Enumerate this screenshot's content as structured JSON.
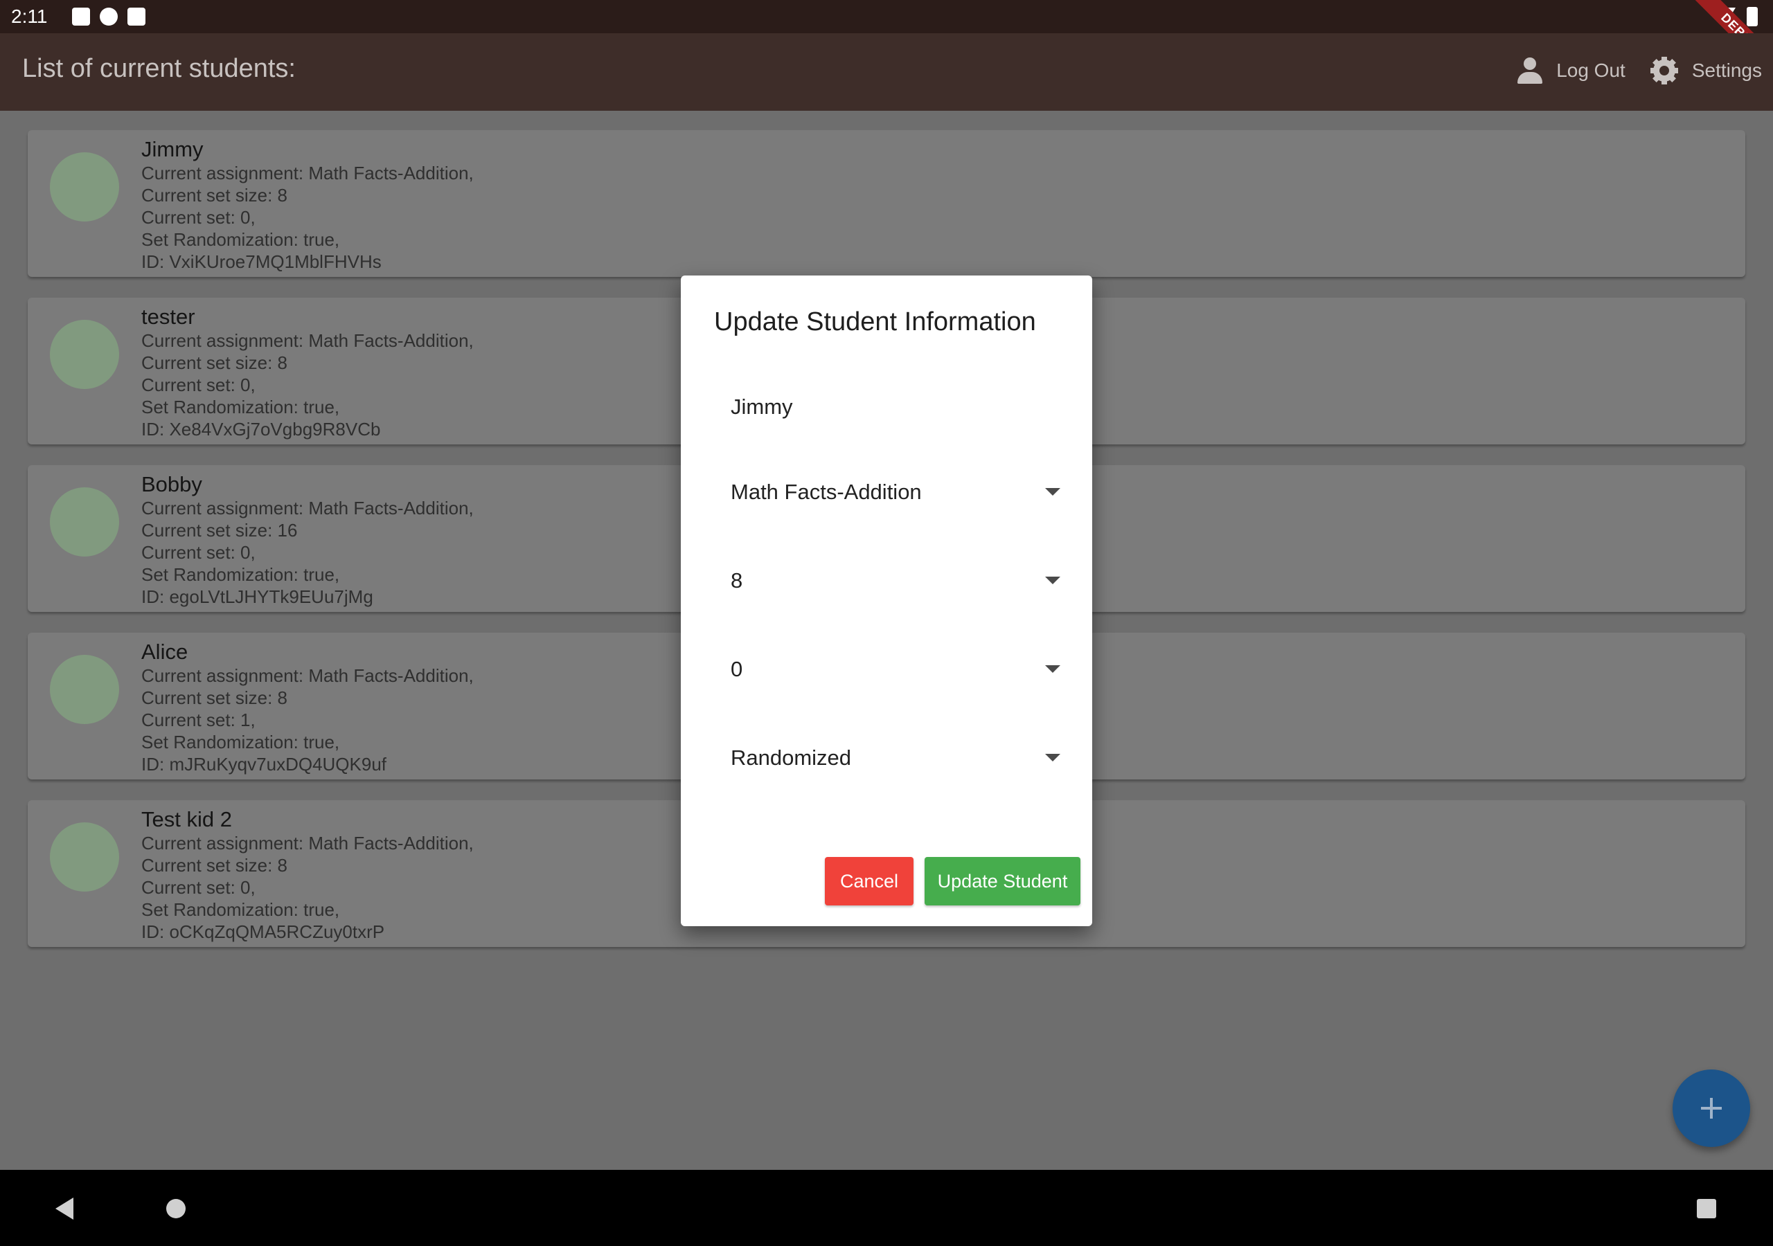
{
  "status_bar": {
    "time": "2:11",
    "debug_label": "DEBUG"
  },
  "app_bar": {
    "title": "List of current students:",
    "logout_label": "Log Out",
    "settings_label": "Settings"
  },
  "students": [
    {
      "name": "Jimmy",
      "assignment": "Current assignment: Math Facts-Addition,",
      "set_size": "Current set size: 8",
      "current_set": "Current set: 0,",
      "randomization": "Set Randomization: true,",
      "id": "ID: VxiKUroe7MQ1MblFHVHs"
    },
    {
      "name": "tester",
      "assignment": "Current assignment: Math Facts-Addition,",
      "set_size": "Current set size: 8",
      "current_set": "Current set: 0,",
      "randomization": "Set Randomization: true,",
      "id": "ID: Xe84VxGj7oVgbg9R8VCb"
    },
    {
      "name": "Bobby",
      "assignment": "Current assignment: Math Facts-Addition,",
      "set_size": "Current set size: 16",
      "current_set": "Current set: 0,",
      "randomization": "Set Randomization: true,",
      "id": "ID: egoLVtLJHYTk9EUu7jMg"
    },
    {
      "name": "Alice",
      "assignment": "Current assignment: Math Facts-Addition,",
      "set_size": "Current set size: 8",
      "current_set": "Current set: 1,",
      "randomization": "Set Randomization: true,",
      "id": "ID: mJRuKyqv7uxDQ4UQK9uf"
    },
    {
      "name": "Test kid 2",
      "assignment": "Current assignment: Math Facts-Addition,",
      "set_size": "Current set size: 8",
      "current_set": "Current set: 0,",
      "randomization": "Set Randomization: true,",
      "id": "ID: oCKqZqQMA5RCZuy0txrP"
    }
  ],
  "dialog": {
    "title": "Update Student Information",
    "name_value": "Jimmy",
    "assignment_value": "Math Facts-Addition",
    "set_size_value": "8",
    "current_set_value": "0",
    "randomization_value": "Randomized",
    "cancel_label": "Cancel",
    "update_label": "Update Student"
  },
  "colors": {
    "cancel": "#f0423a",
    "update": "#46ad4d",
    "fab": "#1c548a",
    "app_bar": "#3e2d29"
  },
  "icons": {
    "logout": "person-icon",
    "settings": "gear-icon",
    "fab": "plus-icon",
    "dropdown": "arrow-drop-down-icon"
  }
}
